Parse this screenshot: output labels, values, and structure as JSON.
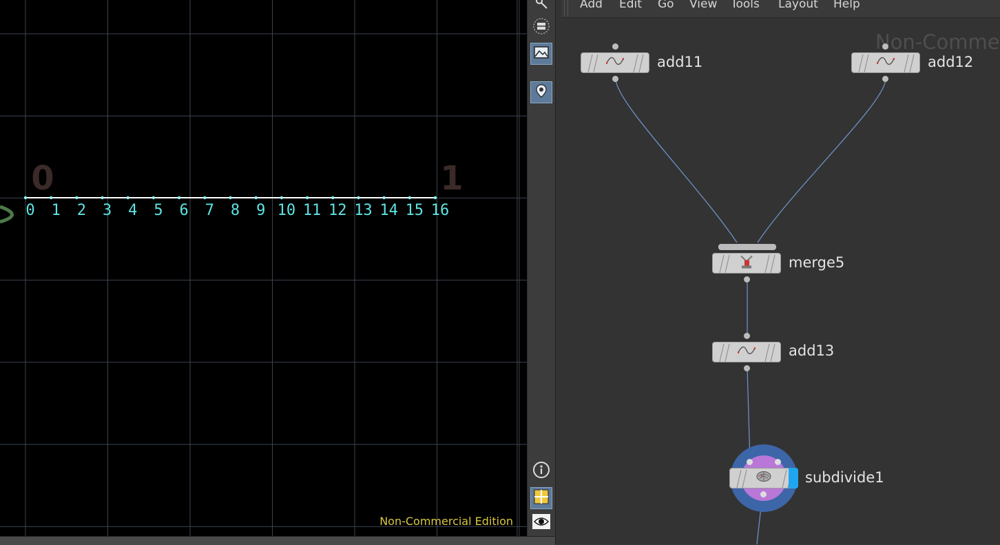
{
  "viewport": {
    "big_labels": [
      "0",
      "1"
    ],
    "point_labels": [
      "0",
      "1",
      "2",
      "3",
      "4",
      "5",
      "6",
      "7",
      "8",
      "9",
      "10",
      "11",
      "12",
      "13",
      "14",
      "15",
      "16"
    ],
    "watermark": "Non-Commercial Edition",
    "colors": {
      "background": "#000000",
      "grid": "#3c4450",
      "point_label": "#5fe3e3",
      "line": "#ffffff"
    }
  },
  "toolbar": {
    "tools": [
      {
        "name": "select-tool-icon",
        "active": false
      },
      {
        "name": "display-options-icon",
        "active": false
      },
      {
        "name": "background-image-icon",
        "active": true
      },
      {
        "name": "pin-icon",
        "active": true
      },
      {
        "name": "info-icon",
        "active": false
      },
      {
        "name": "viewport-layout-icon",
        "active": true
      },
      {
        "name": "visibility-eye-icon",
        "active": false
      }
    ]
  },
  "network": {
    "menu": [
      "Add",
      "Edit",
      "Go",
      "View",
      "Tools",
      "Layout",
      "Help"
    ],
    "watermark": "Non-Commercial Edition",
    "nodes": [
      {
        "id": "add11",
        "label": "add11",
        "icon": "curve-icon"
      },
      {
        "id": "add12",
        "label": "add12",
        "icon": "curve-icon"
      },
      {
        "id": "merge5",
        "label": "merge5",
        "icon": "merge-icon"
      },
      {
        "id": "add13",
        "label": "add13",
        "icon": "curve-icon"
      },
      {
        "id": "subdivide1",
        "label": "subdivide1",
        "icon": "subdivide-icon",
        "display_flag": true
      }
    ],
    "colors": {
      "wire": "#6d8fc6",
      "node_body": "#d0d0d0",
      "display_flag": "#20a6f0"
    }
  }
}
